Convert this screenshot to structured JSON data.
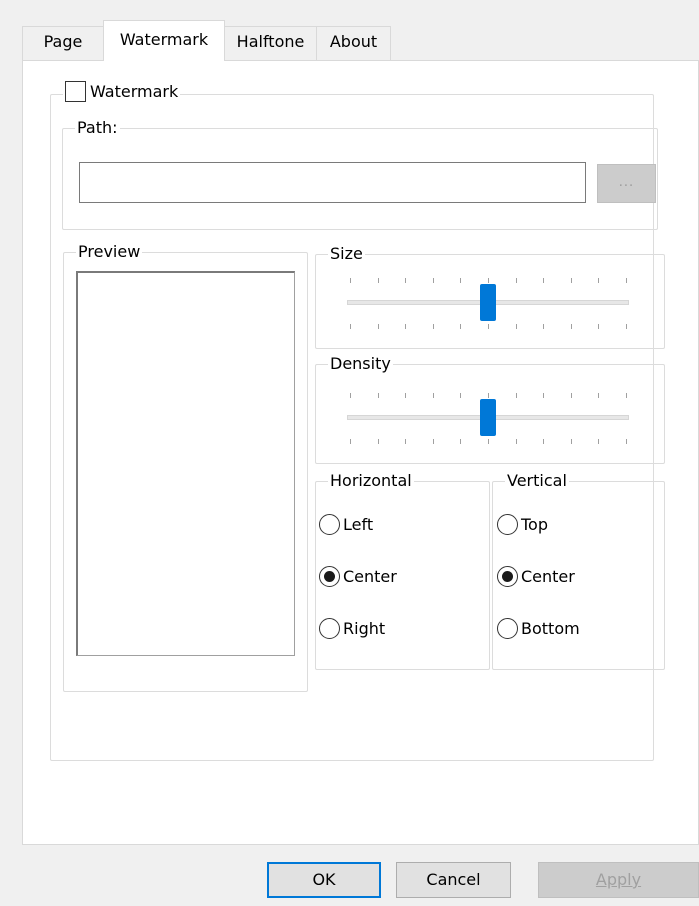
{
  "tabs": [
    {
      "label": "Page",
      "active": false
    },
    {
      "label": "Watermark",
      "active": true
    },
    {
      "label": "Halftone",
      "active": false
    },
    {
      "label": "About",
      "active": false
    }
  ],
  "watermark": {
    "checkbox_label": "Watermark",
    "checked": false,
    "path": {
      "group_label": "Path:",
      "value": "",
      "browse_label": "..."
    },
    "preview": {
      "group_label": "Preview"
    },
    "size": {
      "group_label": "Size",
      "value_fraction": 0.5
    },
    "density": {
      "group_label": "Density",
      "value_fraction": 0.5
    },
    "horizontal": {
      "group_label": "Horizontal",
      "options": [
        "Left",
        "Center",
        "Right"
      ],
      "selected": "Center"
    },
    "vertical": {
      "group_label": "Vertical",
      "options": [
        "Top",
        "Center",
        "Bottom"
      ],
      "selected": "Center"
    }
  },
  "buttons": {
    "ok": "OK",
    "cancel": "Cancel",
    "apply": "Apply",
    "apply_enabled": false
  },
  "colors": {
    "accent": "#0078d7",
    "panel": "#ffffff",
    "window": "#f0f0f0",
    "disabled_text": "#a0a0a0"
  }
}
